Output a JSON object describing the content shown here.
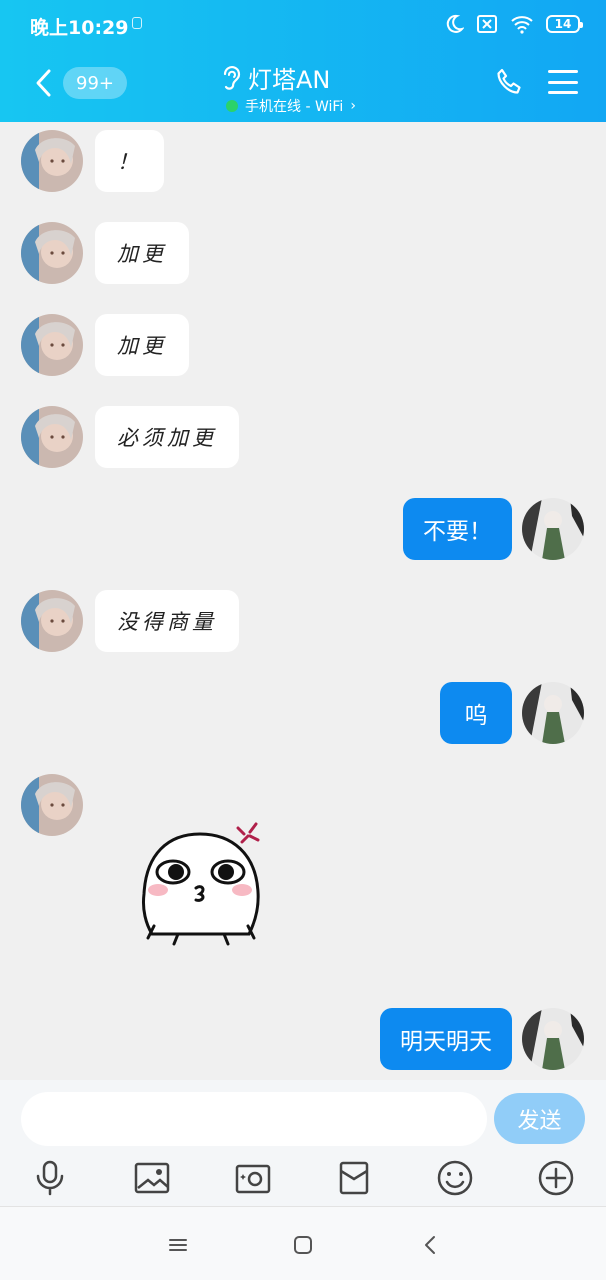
{
  "status_bar": {
    "time": "晚上10:29",
    "battery": "14"
  },
  "header": {
    "badge": "99+",
    "title": "灯塔AN",
    "subtitle": "手机在线 - WiFi",
    "subtitle_suffix": "›"
  },
  "messages": [
    {
      "side": "in",
      "text": "！"
    },
    {
      "side": "in",
      "text": "加更"
    },
    {
      "side": "in",
      "text": "加更"
    },
    {
      "side": "in",
      "text": "必须加更"
    },
    {
      "side": "out",
      "text": "不要！"
    },
    {
      "side": "in",
      "text": "没得商量"
    },
    {
      "side": "out",
      "text": "呜"
    },
    {
      "side": "in",
      "sticker": "angry-face-sticker"
    },
    {
      "side": "out",
      "text": "明天明天"
    }
  ],
  "input": {
    "placeholder": "",
    "send_label": "发送"
  },
  "colors": {
    "header_gradient_start": "#17c6f2",
    "header_gradient_end": "#12a7f3",
    "outgoing_bubble": "#0d8af0",
    "chat_background": "#f0f0f0",
    "send_button": "#91cdf8"
  },
  "icons": [
    "back-icon",
    "ear-icon",
    "phone-icon",
    "menu-icon",
    "mic-icon",
    "image-icon",
    "camera-icon",
    "red-packet-icon",
    "emoji-icon",
    "plus-icon"
  ]
}
